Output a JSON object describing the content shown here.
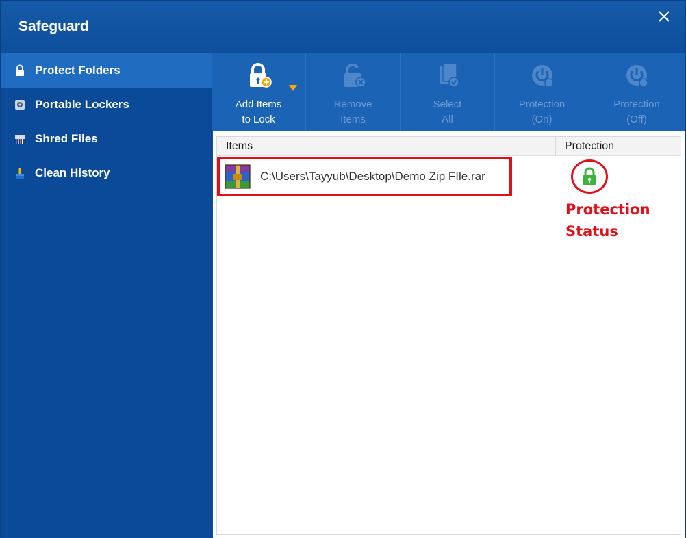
{
  "app": {
    "title": "Safeguard"
  },
  "sidebar": {
    "items": [
      {
        "label": "Protect Folders",
        "icon": "lock-icon",
        "active": true
      },
      {
        "label": "Portable Lockers",
        "icon": "locker-icon",
        "active": false
      },
      {
        "label": "Shred Files",
        "icon": "shredder-icon",
        "active": false
      },
      {
        "label": "Clean History",
        "icon": "brush-icon",
        "active": false
      }
    ]
  },
  "toolbar": {
    "buttons": [
      {
        "label": "Add Items\nto Lock",
        "icon": "lock-add-icon",
        "enabled": true,
        "has_dropdown": true
      },
      {
        "label": "Remove\nItems",
        "icon": "lock-remove-icon",
        "enabled": false
      },
      {
        "label": "Select\nAll",
        "icon": "select-all-icon",
        "enabled": false
      },
      {
        "label": "Protection\n(On)",
        "icon": "power-on-icon",
        "enabled": false
      },
      {
        "label": "Protection\n(Off)",
        "icon": "power-off-icon",
        "enabled": false
      }
    ]
  },
  "list": {
    "columns": [
      "Items",
      "Protection"
    ],
    "rows": [
      {
        "path": "C:\\Users\\Tayyub\\Desktop\\Demo Zip FIle.rar",
        "file_icon": "winrar-archive-icon",
        "protection_icon": "lock-green-icon"
      }
    ]
  },
  "annotation": {
    "text": "Protection\nStatus"
  },
  "colors": {
    "accent": "#0d4f9c",
    "sidebar_active": "#1f6cc0",
    "toolbar": "#1b63b4",
    "highlight_red": "#e0101b",
    "status_green": "#3cb43c",
    "dropdown_caret": "#f5a800"
  }
}
